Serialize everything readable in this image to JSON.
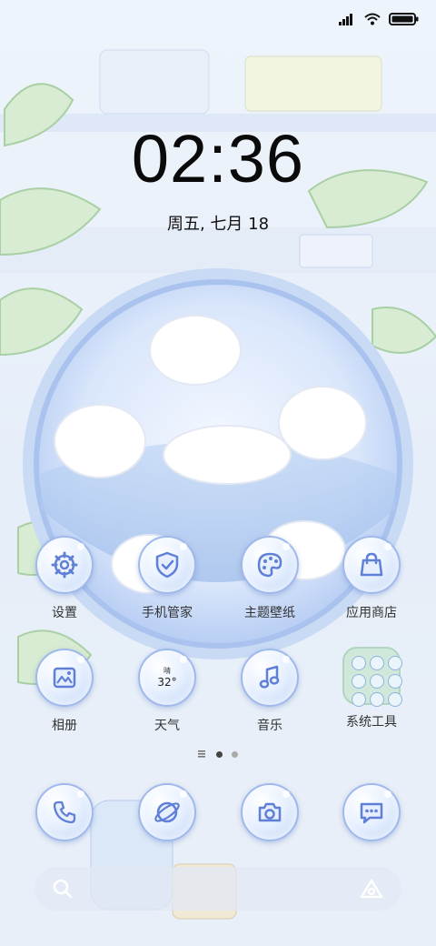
{
  "status_bar": {
    "signal_icon": "signal-icon",
    "wifi_icon": "wifi-icon",
    "battery_icon": "battery-icon"
  },
  "clock": {
    "time": "02:36",
    "date": "周五, 七月 18"
  },
  "apps_row1": [
    {
      "label": "设置",
      "icon": "gear-icon"
    },
    {
      "label": "手机管家",
      "icon": "shield-check-icon"
    },
    {
      "label": "主题壁纸",
      "icon": "palette-icon"
    },
    {
      "label": "应用商店",
      "icon": "shopping-bag-icon"
    }
  ],
  "apps_row2": [
    {
      "label": "相册",
      "icon": "photo-icon"
    },
    {
      "label": "天气",
      "icon": "weather-icon",
      "temp": "32°",
      "condition": "晴"
    },
    {
      "label": "音乐",
      "icon": "music-note-icon"
    },
    {
      "label": "系统工具",
      "icon": "folder-icon"
    }
  ],
  "page_dots": {
    "count": 3,
    "active": 1
  },
  "dock": [
    {
      "icon": "phone-icon"
    },
    {
      "icon": "browser-icon"
    },
    {
      "icon": "camera-icon"
    },
    {
      "icon": "message-icon"
    }
  ],
  "searchbar": {
    "search_icon": "search-icon",
    "assistant_icon": "assistant-icon"
  },
  "colors": {
    "icon_stroke": "#6f8fe0",
    "bubble_edge": "#9fb9ec",
    "text": "#333333"
  }
}
